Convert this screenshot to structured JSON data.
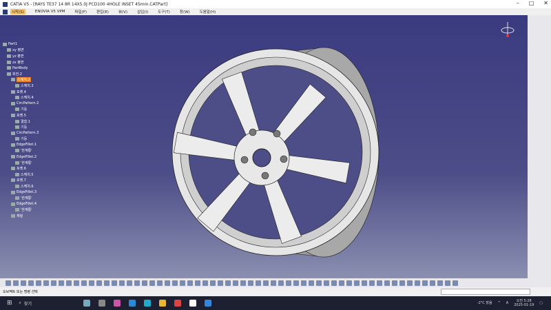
{
  "window": {
    "title": "CATIA V5 - [RAYS TE37 14 8R 14X5.0J PCD100 4HOLE INSET 45mm.CATPart]",
    "controls": [
      "–",
      "□",
      "✕"
    ]
  },
  "menu": [
    "시작(S)",
    "ENOVIA V5 VPM",
    "파일(F)",
    "편집(E)",
    "뷰(V)",
    "삽입(I)",
    "도구(T)",
    "창(W)",
    "도움말(H)"
  ],
  "tree": [
    {
      "label": "Part1",
      "depth": 0
    },
    {
      "label": "xy 평면",
      "depth": 1
    },
    {
      "label": "yz 평면",
      "depth": 1
    },
    {
      "label": "zx 평면",
      "depth": 1
    },
    {
      "label": "PartBody",
      "depth": 1
    },
    {
      "label": "회전.2",
      "depth": 1
    },
    {
      "label": "스케치.2",
      "depth": 2,
      "selected": true
    },
    {
      "label": "스케치.3",
      "depth": 3
    },
    {
      "label": "포켓.4",
      "depth": 2
    },
    {
      "label": "스케치.4",
      "depth": 3
    },
    {
      "label": "CircPattern.2",
      "depth": 2
    },
    {
      "label": "기둥",
      "depth": 3
    },
    {
      "label": "포켓.5",
      "depth": 2
    },
    {
      "label": "결합.1",
      "depth": 3
    },
    {
      "label": "기둥",
      "depth": 3
    },
    {
      "label": "CircPattern.3",
      "depth": 2
    },
    {
      "label": "기둥",
      "depth": 3
    },
    {
      "label": "EdgeFillet.1",
      "depth": 2
    },
    {
      "label": "'한계통'",
      "depth": 3
    },
    {
      "label": "EdgeFillet.2",
      "depth": 2
    },
    {
      "label": "'한계통'",
      "depth": 3
    },
    {
      "label": "포켓.6",
      "depth": 2
    },
    {
      "label": "스케치.5",
      "depth": 3
    },
    {
      "label": "포켓.7",
      "depth": 2
    },
    {
      "label": "스케치.6",
      "depth": 3
    },
    {
      "label": "EdgeFillet.3",
      "depth": 2
    },
    {
      "label": "'한계통'",
      "depth": 3
    },
    {
      "label": "EdgeFillet.4",
      "depth": 2
    },
    {
      "label": "'한계통'",
      "depth": 3
    },
    {
      "label": "재질",
      "depth": 2
    }
  ],
  "status": {
    "prompt": "오브젝트 또는 명령 선택"
  },
  "taskbar": {
    "search": "찾기",
    "weather": "-2°C 맑음",
    "time": "오전 5:28",
    "date": "2025-01-19",
    "lang": "A"
  },
  "colors": {
    "viewport_top": "#3a3a80",
    "selected": "#f08020"
  }
}
